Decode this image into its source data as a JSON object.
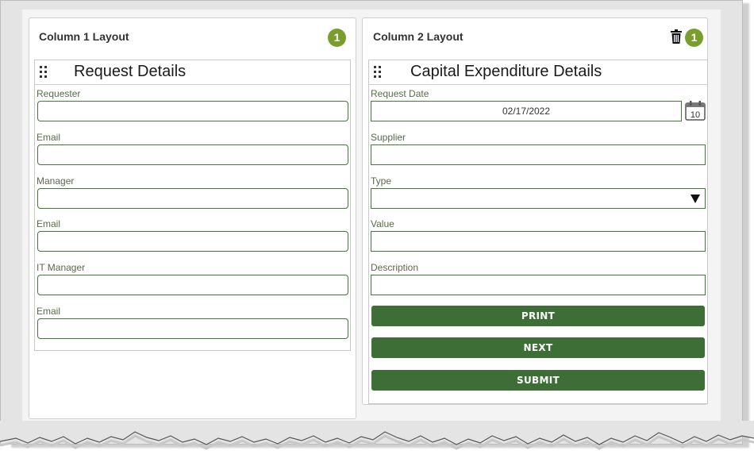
{
  "column1": {
    "title": "Column 1 Layout",
    "badge": "1",
    "section": {
      "title": "Request Details",
      "fields": [
        {
          "label": "Requester",
          "value": ""
        },
        {
          "label": "Email",
          "value": ""
        },
        {
          "label": "Manager",
          "value": ""
        },
        {
          "label": "Email",
          "value": ""
        },
        {
          "label": "IT Manager",
          "value": ""
        },
        {
          "label": "Email",
          "value": ""
        }
      ]
    }
  },
  "column2": {
    "title": "Column 2 Layout",
    "badge": "1",
    "section": {
      "title": "Capital Expenditure Details",
      "request_date": {
        "label": "Request Date",
        "value": "02/17/2022"
      },
      "calendar_day": "10",
      "supplier": {
        "label": "Supplier",
        "value": ""
      },
      "type": {
        "label": "Type",
        "value": ""
      },
      "value": {
        "label": "Value",
        "value": ""
      },
      "description": {
        "label": "Description",
        "value": ""
      }
    },
    "buttons": {
      "print": "PRINT",
      "next": "NEXT",
      "submit": "SUBMIT"
    }
  },
  "colors": {
    "accent_green": "#3d6e36",
    "badge_green": "#7a9e2d",
    "field_border": "#3f7a36"
  },
  "icons": [
    "drag-grip-icon",
    "trash-icon",
    "calendar-icon",
    "dropdown-arrow-icon"
  ]
}
